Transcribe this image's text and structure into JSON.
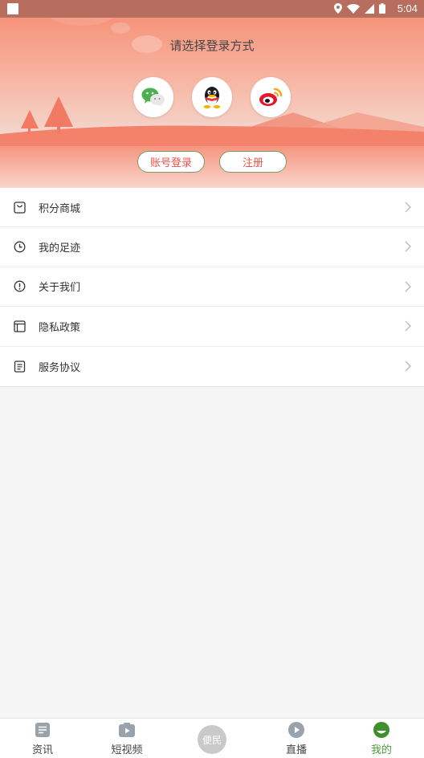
{
  "status_bar": {
    "time": "5:04"
  },
  "header": {
    "title": "请选择登录方式",
    "social": [
      {
        "name": "wechat-icon"
      },
      {
        "name": "qq-icon"
      },
      {
        "name": "weibo-icon"
      }
    ],
    "login_label": "账号登录",
    "register_label": "注册"
  },
  "menu": {
    "items": [
      {
        "label": "积分商城",
        "icon": "shopping-bag-icon"
      },
      {
        "label": "我的足迹",
        "icon": "clock-icon"
      },
      {
        "label": "关于我们",
        "icon": "info-icon"
      },
      {
        "label": "隐私政策",
        "icon": "window-icon"
      },
      {
        "label": "服务协议",
        "icon": "document-icon"
      }
    ]
  },
  "bottom_nav": {
    "items": [
      {
        "label": "资讯",
        "icon": "news-icon"
      },
      {
        "label": "短视频",
        "icon": "short-video-icon"
      },
      {
        "label": "直播",
        "icon": "play-icon"
      },
      {
        "label": "我的",
        "icon": "profile-icon",
        "active": true
      }
    ],
    "center_label": "便民"
  },
  "colors": {
    "accent": "#4f9b3a",
    "login_text": "#e8524a",
    "header_top": "#f6937a"
  }
}
